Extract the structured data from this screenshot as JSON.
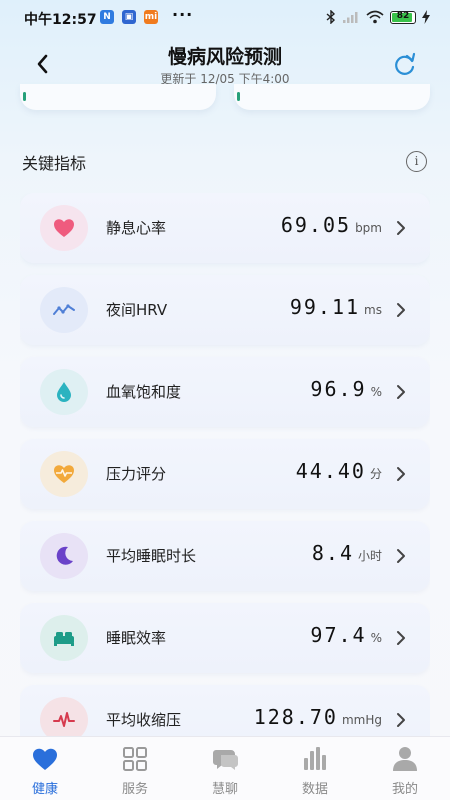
{
  "status_bar": {
    "time": "中午12:57",
    "dots": "···",
    "battery": "82",
    "battery_level": 0.82
  },
  "header": {
    "title": "慢病风险预测",
    "subtitle": "更新于 12/05 下午4:00"
  },
  "section": {
    "title": "关键指标",
    "info_icon": "i"
  },
  "metrics": [
    {
      "label": "静息心率",
      "value": "69.05",
      "unit": "bpm",
      "icon": "heart-icon",
      "color": "#ef5b7e",
      "bg": "#f6e4ee"
    },
    {
      "label": "夜间HRV",
      "value": "99.11",
      "unit": "ms",
      "icon": "hrv-trend-icon",
      "color": "#4f7fd6",
      "bg": "#e3eaf9"
    },
    {
      "label": "血氧饱和度",
      "value": "96.9",
      "unit": "%",
      "icon": "water-drop-icon",
      "color": "#2bb3c0",
      "bg": "#dff0f3"
    },
    {
      "label": "压力评分",
      "value": "44.40",
      "unit": "分",
      "icon": "stress-heart-icon",
      "color": "#f2a93b",
      "bg": "#f6ecdc"
    },
    {
      "label": "平均睡眠时长",
      "value": "8.4",
      "unit": "小时",
      "icon": "moon-icon",
      "color": "#6a42c9",
      "bg": "#e8e2f6"
    },
    {
      "label": "睡眠效率",
      "value": "97.4",
      "unit": "%",
      "icon": "bed-icon",
      "color": "#1d9c88",
      "bg": "#ddefec"
    },
    {
      "label": "平均收缩压",
      "value": "128.70",
      "unit": "mmHg",
      "icon": "pulse-icon",
      "color": "#d63a4e",
      "bg": "#f5e2e6"
    }
  ],
  "bottom_nav": [
    {
      "label": "健康",
      "icon": "heart-icon",
      "active": true
    },
    {
      "label": "服务",
      "icon": "grid-icon",
      "active": false
    },
    {
      "label": "慧聊",
      "icon": "chat-icon",
      "active": false
    },
    {
      "label": "数据",
      "icon": "bar-chart-icon",
      "active": false
    },
    {
      "label": "我的",
      "icon": "person-icon",
      "active": false
    }
  ],
  "colors": {
    "accent": "#2a6fdb",
    "refresh": "#2b8fd6"
  }
}
